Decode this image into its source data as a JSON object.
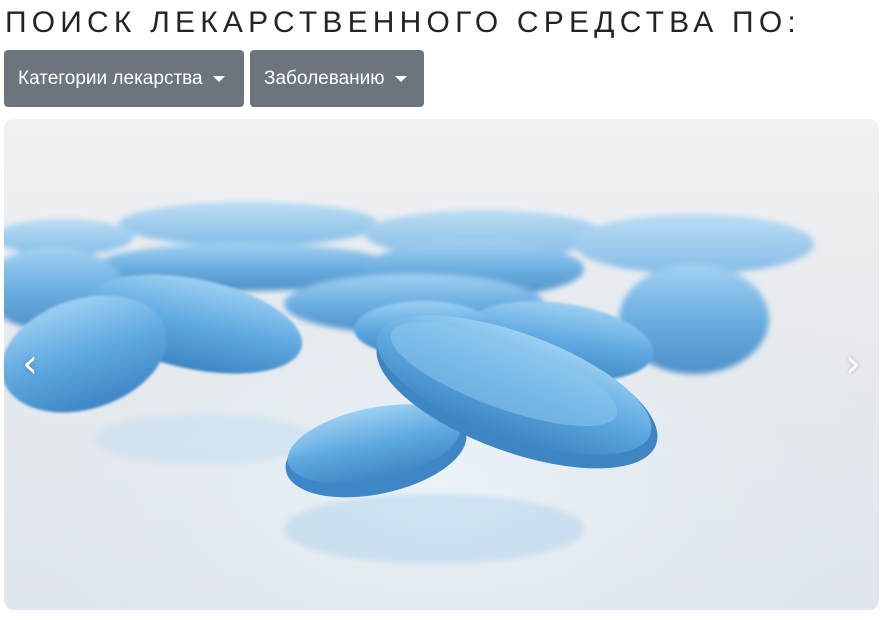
{
  "page": {
    "title": "ПОИСК ЛЕКАРСТВЕННОГО СРЕДСТВА ПО:"
  },
  "filters": {
    "categories_label": "Категории лекарства",
    "disease_label": "Заболеванию"
  },
  "carousel": {
    "image_subject": "blue-pills-photo",
    "prev_icon": "chevron-left-icon",
    "next_icon": "chevron-right-icon",
    "prev_glyph": "‹",
    "next_glyph": "›"
  },
  "colors": {
    "button_bg": "#6c757d",
    "pill_blue": "#5aa7df",
    "pill_light": "#8cc6ef"
  }
}
